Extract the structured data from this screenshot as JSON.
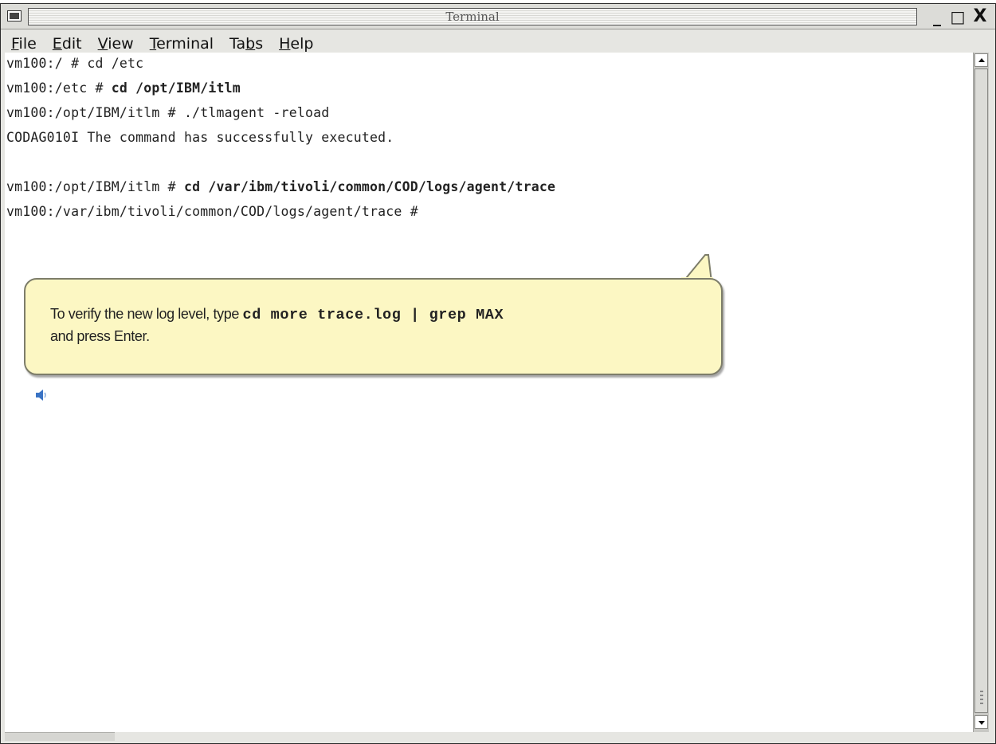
{
  "window": {
    "title": "Terminal",
    "minimize_label": "_",
    "maximize_label": "□",
    "close_label": "X"
  },
  "menubar": {
    "items": [
      {
        "mnemonic": "F",
        "rest": "ile"
      },
      {
        "mnemonic": "E",
        "rest": "dit"
      },
      {
        "mnemonic": "V",
        "rest": "iew"
      },
      {
        "mnemonic": "T",
        "rest": "erminal"
      },
      {
        "pre": "Ta",
        "mnemonic": "b",
        "rest": "s"
      },
      {
        "mnemonic": "H",
        "rest": "elp"
      }
    ]
  },
  "terminal": {
    "lines": [
      {
        "prompt": "vm100:/ # ",
        "command": "cd /etc"
      },
      {
        "prompt": "vm100:/etc # ",
        "command": "cd /opt/IBM/itlm"
      },
      {
        "prompt": "vm100:/opt/IBM/itlm # ",
        "command": "./tlmagent -reload"
      },
      {
        "prompt": "",
        "command": "CODAG010I The command has successfully executed."
      },
      {
        "prompt": "",
        "command": ""
      },
      {
        "prompt": "vm100:/opt/IBM/itlm # ",
        "command": "cd /var/ibm/tivoli/common/COD/logs/agent/trace"
      },
      {
        "prompt": "vm100:/var/ibm/tivoli/common/COD/logs/agent/trace # ",
        "command": ""
      }
    ]
  },
  "callout": {
    "text_before": "To verify the new log level, type ",
    "command": "cd more trace.log | grep MAX",
    "text_after": "and press Enter."
  },
  "icons": {
    "speaker": "speaker-icon",
    "window_menu": "window-menu-icon"
  }
}
